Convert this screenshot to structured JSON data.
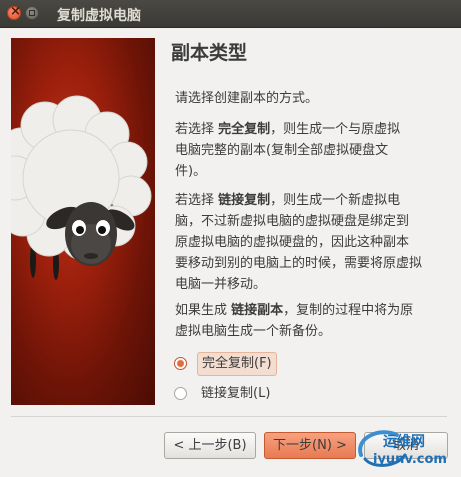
{
  "window": {
    "title": "复制虚拟电脑",
    "close_icon": "close-icon",
    "minimize_icon": "minimize-icon"
  },
  "page": {
    "heading": "副本类型",
    "intro": "请选择创建副本的方式。",
    "full_clone_para": {
      "prefix": "若选择 ",
      "term": "完全复制",
      "line1_rest": "，则生成一个与原虚拟",
      "line2": "电脑完整的副本(复制全部虚拟硬盘文",
      "line3": "件)。"
    },
    "linked_clone_para": {
      "prefix": "若选择 ",
      "term": "链接复制",
      "line1_rest": "，则生成一个新虚拟电",
      "line2": "脑，不过新虚拟电脑的虚拟硬盘是绑定到",
      "line3": "原虚拟电脑的虚拟硬盘的，因此这种副本",
      "line4": "要移动到别的电脑上的时候，需要将原虚拟",
      "line5": "电脑一并移动。"
    },
    "linked_note_para": {
      "prefix": "如果生成 ",
      "term": "链接副本",
      "line1_rest": "，复制的过程中将为原",
      "line2": "虚拟电脑生成一个新备份。"
    },
    "options": [
      {
        "label": "完全复制(F)",
        "selected": true
      },
      {
        "label": "链接复制(L)",
        "selected": false
      }
    ]
  },
  "buttons": {
    "back": "< 上一步(B)",
    "next": "下一步(N) >",
    "cancel": "取消"
  },
  "watermark": {
    "line1": "运维网",
    "line2": "iyunv.com"
  },
  "colors": {
    "titlebar": "#3c3b37",
    "accent": "#e87a52",
    "artwork_bg": "#8a1a0a"
  }
}
